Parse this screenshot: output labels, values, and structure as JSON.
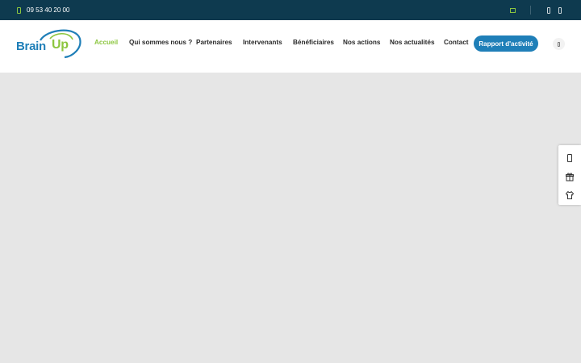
{
  "topbar": {
    "phone": "09 53 40 20 00",
    "icons": [
      "phone-icon",
      "flag-icon",
      "facebook-icon",
      "linkedin-icon"
    ]
  },
  "logo": {
    "part1": "Brain",
    "part2": "Up"
  },
  "nav": {
    "items": [
      {
        "label": "Accueil",
        "active": true
      },
      {
        "label": "Qui sommes nous ?"
      },
      {
        "label": "Partenaires"
      },
      {
        "label": "Intervenants"
      },
      {
        "label": "Bénéficiaires"
      },
      {
        "label": "Nos actions"
      },
      {
        "label": "Nos actualités"
      },
      {
        "label": "Contact"
      }
    ],
    "cta": "Rapport d'activité"
  },
  "side_panel": {
    "icons": [
      "mobile-icon",
      "gift-icon",
      "shirt-icon"
    ]
  },
  "colors": {
    "topbar": "#0e3a4f",
    "accent_green": "#8cc63f",
    "brand_blue": "#1f7fb8",
    "hero_bg": "#e6e6e6"
  }
}
